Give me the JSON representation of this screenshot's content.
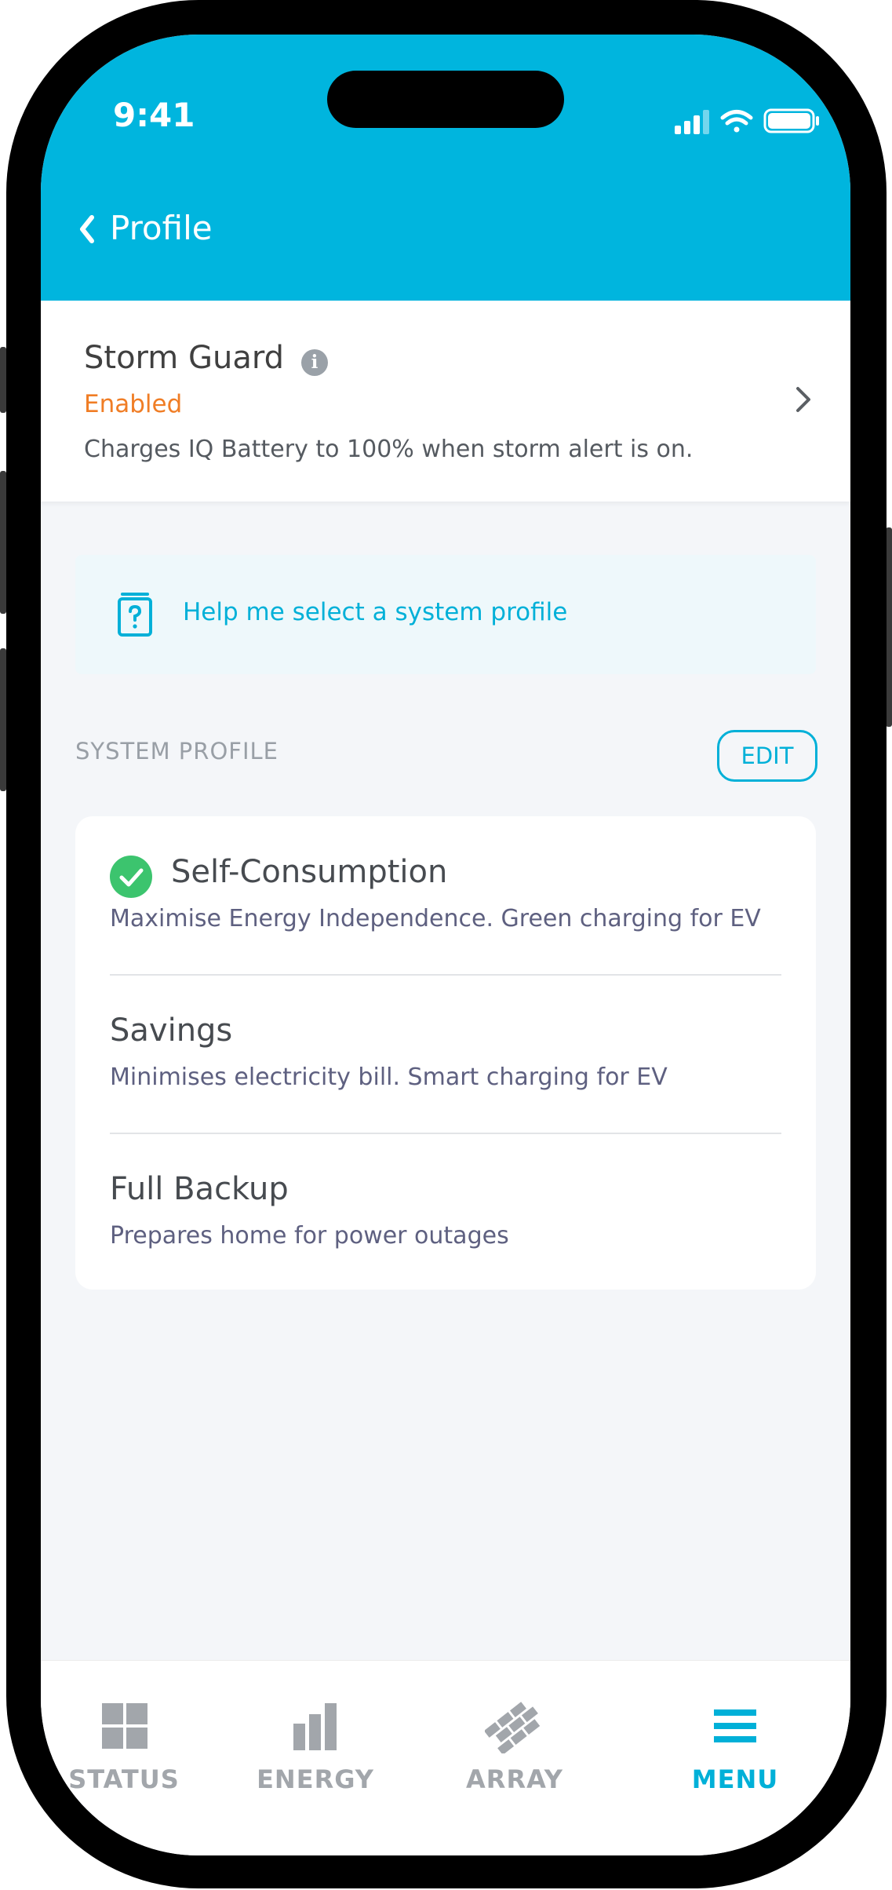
{
  "status_bar": {
    "time": "9:41"
  },
  "nav": {
    "title": "Profile"
  },
  "storm_guard": {
    "title": "Storm Guard",
    "status": "Enabled",
    "description": "Charges IQ Battery to 100% when storm alert is on."
  },
  "help": {
    "label": "Help me select a system profile"
  },
  "system_profile": {
    "section_label": "SYSTEM PROFILE",
    "edit_label": "EDIT",
    "items": [
      {
        "title": "Self-Consumption",
        "description": "Maximise Energy Independence. Green charging for EV",
        "selected": true
      },
      {
        "title": "Savings",
        "description": "Minimises electricity bill. Smart charging for EV",
        "selected": false
      },
      {
        "title": "Full Backup",
        "description": "Prepares home for power outages",
        "selected": false
      }
    ]
  },
  "tabs": [
    {
      "label": "STATUS",
      "icon": "grid-icon",
      "active": false
    },
    {
      "label": "ENERGY",
      "icon": "bar-chart-icon",
      "active": false
    },
    {
      "label": "ARRAY",
      "icon": "solar-array-icon",
      "active": false
    },
    {
      "label": "MENU",
      "icon": "menu-icon",
      "active": true
    }
  ],
  "colors": {
    "header": "#00b5de",
    "accent": "#00b0d8",
    "enabled": "#f07d25",
    "check": "#3cc46e",
    "inactive_tab": "#a2a6ab"
  }
}
